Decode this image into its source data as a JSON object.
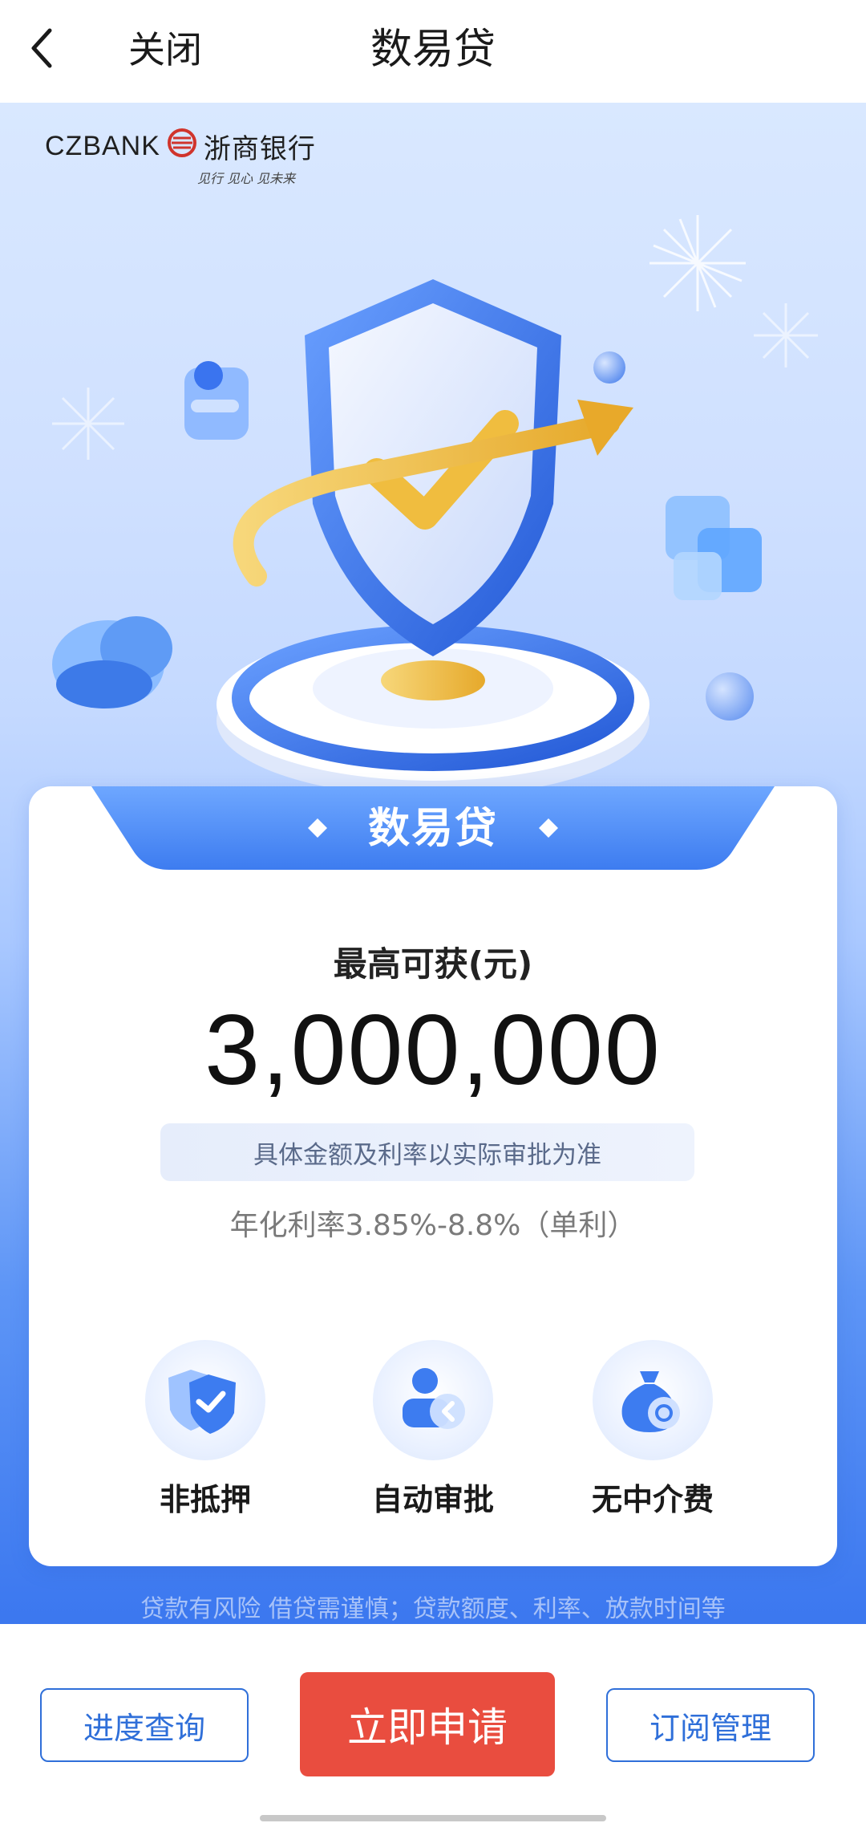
{
  "header": {
    "back_icon": "chevron-left-icon",
    "close_label": "关闭",
    "title": "数易贷"
  },
  "hero": {
    "logo_text": "CZBANK",
    "logo_cn": "浙商银行",
    "logo_slogan": "见行 见心 见未来",
    "illustration": "shield-with-check-and-arrow"
  },
  "card": {
    "tab_title": "数易贷",
    "max_label": "最高可获(元)",
    "amount": "3,000,000",
    "note": "具体金额及利率以实际审批为准",
    "rate": "年化利率3.85%-8.8%（单利）",
    "features": [
      {
        "label": "非抵押",
        "icon": "shield-check-icon"
      },
      {
        "label": "自动审批",
        "icon": "person-approve-icon"
      },
      {
        "label": "无中介费",
        "icon": "money-bag-icon"
      }
    ]
  },
  "disclaimer": "贷款有风险 借贷需谨慎；贷款额度、利率、放款时间等",
  "bottom": {
    "progress_label": "进度查询",
    "apply_label": "立即申请",
    "subscribe_label": "订阅管理"
  },
  "colors": {
    "accent_blue": "#2f6fd9",
    "apply_red": "#e94d3f",
    "gold": "#f2c04a"
  }
}
